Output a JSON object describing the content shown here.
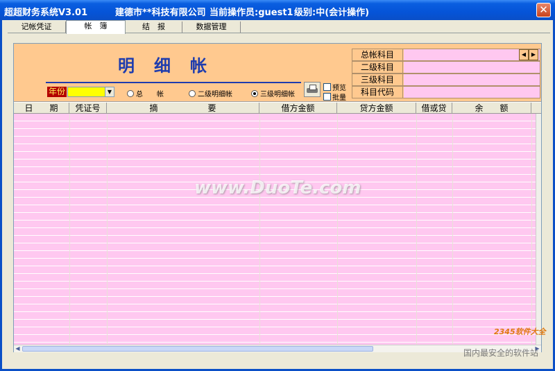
{
  "window": {
    "app_title": "超超财务系统V3.01",
    "company": "建德市**科技有限公司",
    "operator": "当前操作员:guest1",
    "level": "级别:中(会计操作)",
    "close_glyph": "✕"
  },
  "tabs": [
    {
      "label": "记帐凭证",
      "active": false
    },
    {
      "label": "帐　簿",
      "active": true
    },
    {
      "label": "结　报",
      "active": false
    },
    {
      "label": "数据管理",
      "active": false
    }
  ],
  "ledger": {
    "title": "明细帐",
    "year_label": "年份",
    "year_value": "",
    "radios": [
      {
        "label": "总　　帐",
        "selected": false
      },
      {
        "label": "二级明细帐",
        "selected": false
      },
      {
        "label": "三级明细帐",
        "selected": true
      }
    ],
    "preview_label": "预览",
    "batch_label": "批量"
  },
  "subjects": [
    {
      "label": "总帐科目",
      "value": ""
    },
    {
      "label": "二级科目",
      "value": ""
    },
    {
      "label": "三级科目",
      "value": ""
    },
    {
      "label": "科目代码",
      "value": ""
    }
  ],
  "spin": {
    "left": "◀",
    "right": "▶"
  },
  "columns": [
    "日　　期",
    "凭证号",
    "摘　　　　　　要",
    "借方金额",
    "贷方金额",
    "借或贷",
    "余　　额"
  ],
  "rows": [],
  "watermark": {
    "main": "www.DuoTe.com",
    "logo": "2345软件大全",
    "sub": "国内最安全的软件站"
  },
  "colors": {
    "header_bg": "#ffc98f",
    "grid_bg": "#ffc8f0",
    "title_blue": "#1e3cae"
  }
}
